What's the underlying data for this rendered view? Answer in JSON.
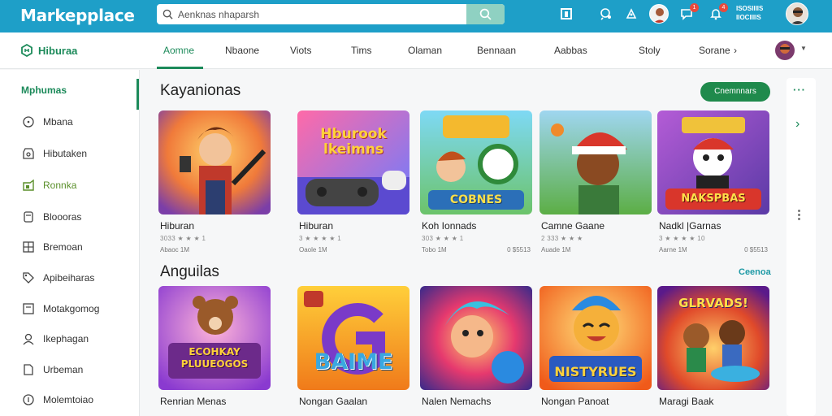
{
  "topbar": {
    "logo": "Markepplace",
    "search_placeholder": "Aenknas nhaparsh",
    "account_lines": [
      "ISOSIIIIS",
      "IIOCIIIIS"
    ],
    "icons": [
      "store-icon",
      "share-icon",
      "compass-icon",
      "user-avatar",
      "chat-icon",
      "bell-icon"
    ],
    "badges": [
      "1",
      "4"
    ]
  },
  "nav": {
    "brand": "Hiburaa",
    "tabs": [
      "Aomne",
      "Nbaone",
      "Viots",
      "Tims",
      "Olaman",
      "Bennaan",
      "Aabbas",
      "Stoly",
      "Sorane"
    ],
    "active_tab": 0
  },
  "sidebar": {
    "heading": "Mphumas",
    "items": [
      {
        "label": "Mbana",
        "icon": "circle-icon"
      },
      {
        "label": "Hibutaken",
        "icon": "store-icon"
      },
      {
        "label": "Ronnka",
        "icon": "gamepad-icon"
      },
      {
        "label": "Bloooras",
        "icon": "bookmark-icon"
      },
      {
        "label": "Bremoan",
        "icon": "grid-icon"
      },
      {
        "label": "Apibeiharas",
        "icon": "tag-icon"
      },
      {
        "label": "Motakgomog",
        "icon": "box-icon"
      },
      {
        "label": "Ikephagan",
        "icon": "user-icon"
      },
      {
        "label": "Urbeman",
        "icon": "page-icon"
      },
      {
        "label": "Molemtoiao",
        "icon": "info-icon"
      }
    ]
  },
  "sections": [
    {
      "title": "Kayanionas",
      "action": "Cnemnnars",
      "cards": [
        {
          "title": "Hiburan",
          "rating": "3033 ★ ★ ★ 1",
          "meta": "Abaoc 1M",
          "extra": "",
          "art": ""
        },
        {
          "title": "Hiburan",
          "rating": "3 ★ ★ ★ ★ 1",
          "meta": "Oaole 1M",
          "extra": "",
          "art": "Hburook\nlkeimns"
        },
        {
          "title": "Koh Ionnads",
          "rating": "303 ★ ★ ★ 1",
          "meta": "Tobo 1M",
          "extra": "0 $5513",
          "art": "COBNES"
        },
        {
          "title": "Camne Gaane",
          "rating": "2 333 ★ ★ ★",
          "meta": "Auade 1M",
          "extra": "",
          "art": ""
        },
        {
          "title": "Nadkl |Garnas",
          "rating": "3 ★ ★ ★ ★ 10",
          "meta": "Aarne 1M",
          "extra": "0 $5513",
          "art": "NAKSPBAS"
        }
      ]
    },
    {
      "title": "Anguilas",
      "action": "Ceenoa",
      "cards": [
        {
          "title": "Renrian Menas",
          "rating": "",
          "meta": "",
          "extra": "",
          "art": "ECOHKAY\nPLUUEOGOS"
        },
        {
          "title": "Nongan Gaalan",
          "rating": "",
          "meta": "",
          "extra": "",
          "art": "BAIME"
        },
        {
          "title": "Nalen Nemachs",
          "rating": "",
          "meta": "",
          "extra": "",
          "art": ""
        },
        {
          "title": "Nongan Panoat",
          "rating": "",
          "meta": "",
          "extra": "",
          "art": "NISTYRUES"
        },
        {
          "title": "Maragi Baak",
          "rating": "",
          "meta": "",
          "extra": "",
          "art": "GLRVADS!"
        }
      ]
    }
  ],
  "colors": {
    "header": "#1e9fc8",
    "accent": "#1c8a5a",
    "pill": "#1f8a4c"
  }
}
